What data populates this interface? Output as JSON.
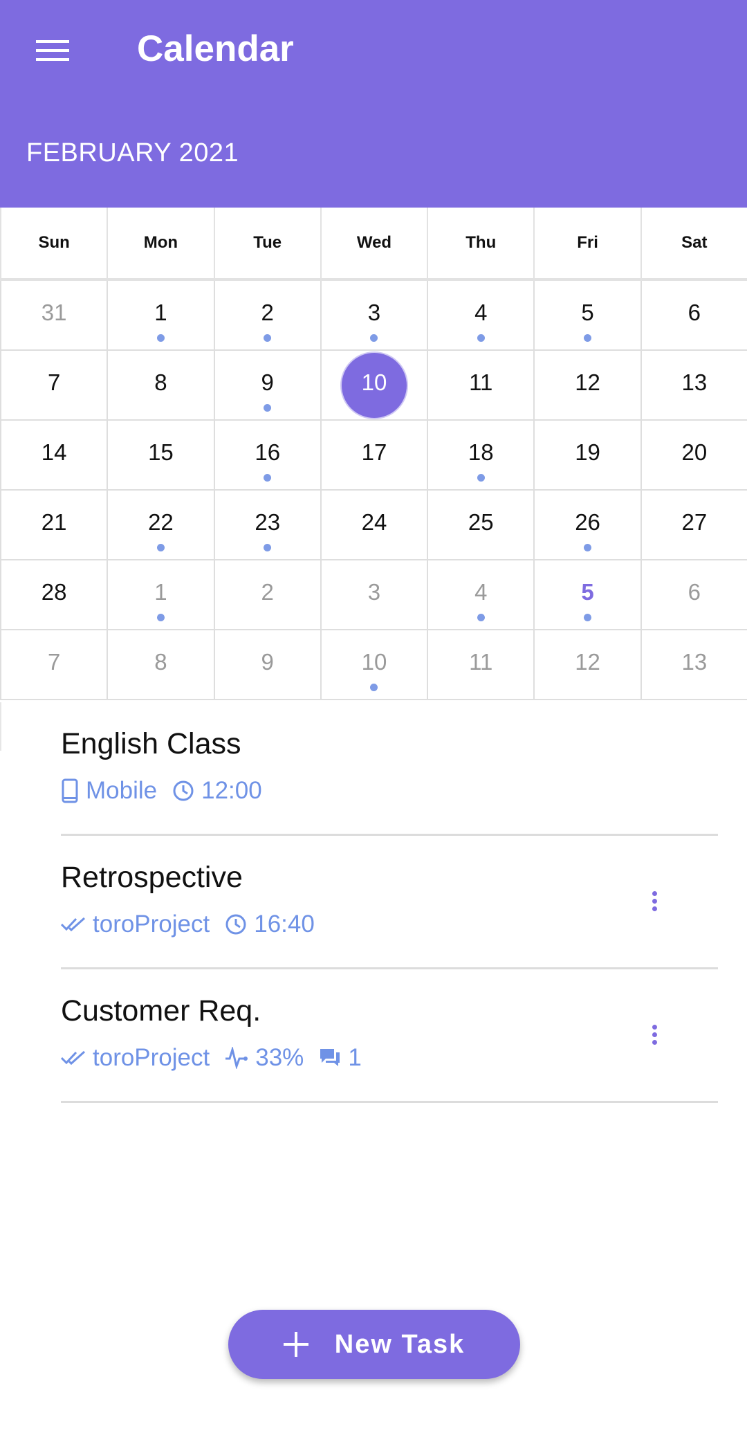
{
  "appbar": {
    "title": "Calendar",
    "menu_icon": "menu-icon",
    "bg_color": "#7e6be0"
  },
  "calendar": {
    "month_label": "FEBRUARY 2021",
    "weekdays": [
      "Sun",
      "Mon",
      "Tue",
      "Wed",
      "Thu",
      "Fri",
      "Sat"
    ],
    "selected_day": "10",
    "dot_color": "#7e9be6",
    "days": [
      {
        "n": "31",
        "muted": true,
        "dot": false
      },
      {
        "n": "1",
        "dot": true
      },
      {
        "n": "2",
        "dot": true
      },
      {
        "n": "3",
        "dot": true
      },
      {
        "n": "4",
        "dot": true
      },
      {
        "n": "5",
        "dot": true
      },
      {
        "n": "6",
        "dot": false
      },
      {
        "n": "7"
      },
      {
        "n": "8"
      },
      {
        "n": "9",
        "dot": true
      },
      {
        "n": "10",
        "selected": true
      },
      {
        "n": "11"
      },
      {
        "n": "12"
      },
      {
        "n": "13"
      },
      {
        "n": "14"
      },
      {
        "n": "15"
      },
      {
        "n": "16",
        "dot": true
      },
      {
        "n": "17"
      },
      {
        "n": "18",
        "dot": true
      },
      {
        "n": "19"
      },
      {
        "n": "20"
      },
      {
        "n": "21"
      },
      {
        "n": "22",
        "dot": true
      },
      {
        "n": "23",
        "dot": true
      },
      {
        "n": "24"
      },
      {
        "n": "25"
      },
      {
        "n": "26",
        "dot": true
      },
      {
        "n": "27"
      },
      {
        "n": "28"
      },
      {
        "n": "1",
        "muted": true,
        "dot": true
      },
      {
        "n": "2",
        "muted": true
      },
      {
        "n": "3",
        "muted": true
      },
      {
        "n": "4",
        "muted": true,
        "dot": true
      },
      {
        "n": "5",
        "accent": true,
        "dot": true
      },
      {
        "n": "6",
        "muted": true
      },
      {
        "n": "7",
        "muted": true
      },
      {
        "n": "8",
        "muted": true
      },
      {
        "n": "9",
        "muted": true
      },
      {
        "n": "10",
        "muted": true,
        "dot": true
      },
      {
        "n": "11",
        "muted": true
      },
      {
        "n": "12",
        "muted": true
      },
      {
        "n": "13",
        "muted": true
      }
    ]
  },
  "tasks": [
    {
      "title": "English Class",
      "meta": [
        {
          "icon": "phone-icon",
          "text": "Mobile"
        },
        {
          "icon": "clock-icon",
          "text": "12:00"
        }
      ],
      "has_menu": false
    },
    {
      "title": "Retrospective",
      "meta": [
        {
          "icon": "double-check-icon",
          "text": "toroProject"
        },
        {
          "icon": "clock-icon",
          "text": "16:40"
        }
      ],
      "has_menu": true
    },
    {
      "title": "Customer Req.",
      "meta": [
        {
          "icon": "double-check-icon",
          "text": "toroProject"
        },
        {
          "icon": "activity-icon",
          "text": "33%"
        },
        {
          "icon": "comment-icon",
          "text": "1"
        }
      ],
      "has_menu": true
    }
  ],
  "fab": {
    "label": "New Task",
    "icon": "plus-icon"
  }
}
